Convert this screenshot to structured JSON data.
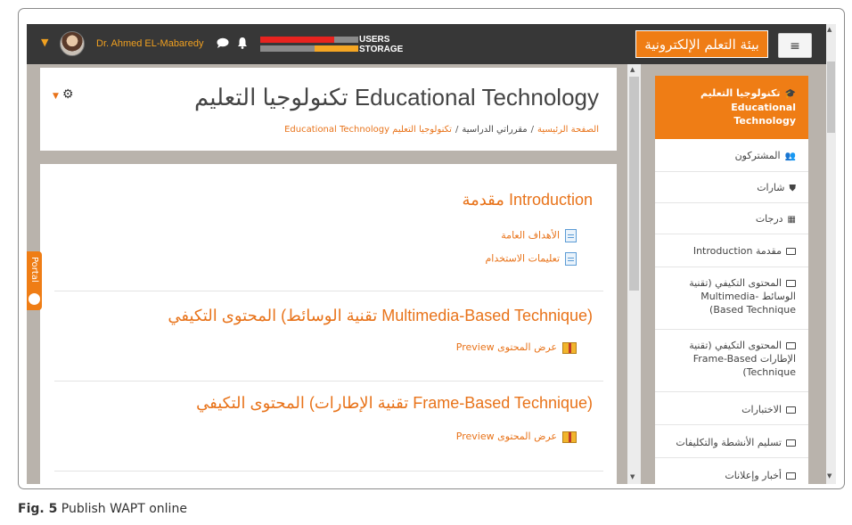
{
  "navbar": {
    "username": "Dr. Ahmed EL-Mabaredy",
    "quota_users_label": "USERS",
    "quota_storage_label": "STORAGE",
    "quota_users_fraction": 0.75,
    "quota_storage_fraction": 0.45,
    "site_title": "بيئة التعلم الإلكترونية",
    "menu_icon": "≡",
    "colors": {
      "bar": "#373737",
      "accent": "#ef7d15",
      "user_quota": "#e8231f",
      "storage_quota": "#f5a623"
    }
  },
  "header": {
    "title": "تكنولوجيا التعليم Educational Technology",
    "breadcrumb": {
      "home": "الصفحة الرئيسية",
      "courses": "مقرراتي الدراسية",
      "current": "تكنولوجيا التعليم Educational Technology"
    }
  },
  "sections": [
    {
      "title": "مقدمة Introduction",
      "activities": [
        {
          "label": "الأهداف العامة",
          "icon": "page-icon"
        },
        {
          "label": "تعليمات الاستخدام",
          "icon": "page-icon"
        }
      ]
    },
    {
      "title": "المحتوى التكيفي (تقنية الوسائط Multimedia-Based Technique)",
      "activities": [
        {
          "label": "عرض المحتوى Preview",
          "icon": "package-icon"
        }
      ]
    },
    {
      "title": "المحتوى التكيفي (تقنية الإطارات Frame-Based Technique)",
      "activities": [
        {
          "label": "عرض المحتوى Preview",
          "icon": "package-icon"
        }
      ]
    }
  ],
  "portal_tab": {
    "label": "Portal"
  },
  "sidebar": {
    "items": [
      {
        "label": "تكنولوجيا التعليم Educational Technology",
        "icon": "graduation-cap-icon",
        "active": true
      },
      {
        "label": "المشتركون",
        "icon": "users-icon"
      },
      {
        "label": "شارات",
        "icon": "shield-icon"
      },
      {
        "label": "درجات",
        "icon": "table-icon"
      },
      {
        "label": "مقدمة Introduction",
        "icon": "folder-icon"
      },
      {
        "label": "المحتوى التكيفي (تقنية الوسائط Multimedia-Based Technique)",
        "icon": "folder-icon"
      },
      {
        "label": "المحتوى التكيفي (تقنية الإطارات Frame-Based Technique)",
        "icon": "folder-icon"
      },
      {
        "label": "الاختبارات",
        "icon": "folder-icon"
      },
      {
        "label": "تسليم الأنشطة والتكليفات",
        "icon": "folder-icon"
      },
      {
        "label": "أخبار وإعلانات",
        "icon": "folder-icon"
      }
    ]
  },
  "caption": {
    "label": "Fig. 5",
    "text": "Publish WAPT online"
  }
}
